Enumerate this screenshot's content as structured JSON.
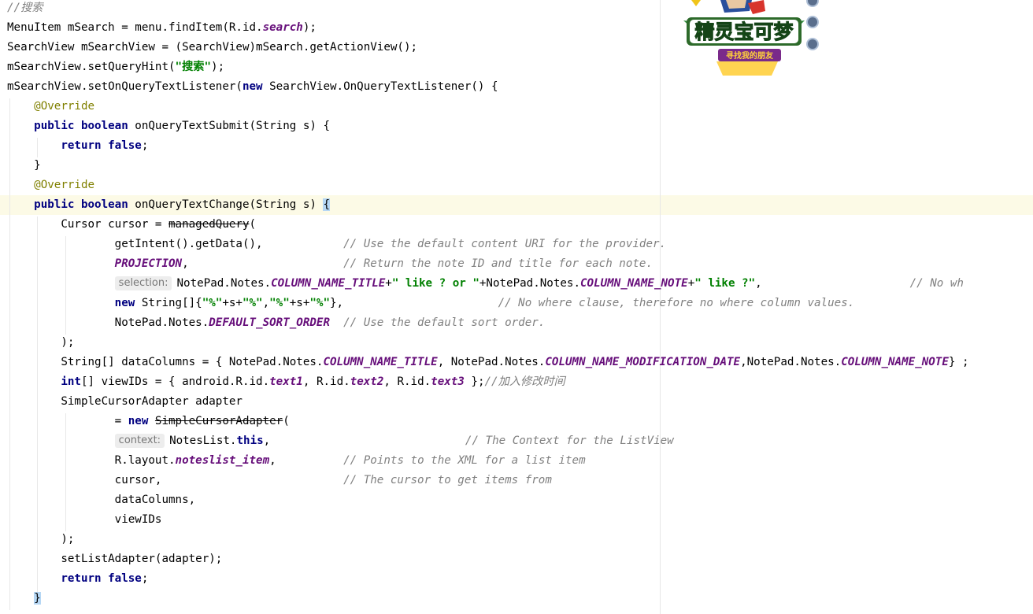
{
  "editor": {
    "lines": [
      {
        "segs": [
          {
            "c": "cmt",
            "t": "//"
          },
          {
            "c": "cmt cjk",
            "t": "搜索"
          }
        ]
      },
      {
        "segs": [
          {
            "t": "MenuItem mSearch = menu.findItem(R.id."
          },
          {
            "c": "fld",
            "t": "search"
          },
          {
            "t": ");"
          }
        ]
      },
      {
        "segs": [
          {
            "t": "SearchView mSearchView = (SearchView)mSearch.getActionView();"
          }
        ]
      },
      {
        "segs": [
          {
            "t": "mSearchView.setQueryHint("
          },
          {
            "c": "str",
            "t": "\""
          },
          {
            "c": "str cjk",
            "t": "搜索"
          },
          {
            "c": "str",
            "t": "\""
          },
          {
            "t": ");"
          }
        ]
      },
      {
        "segs": [
          {
            "t": "mSearchView.setOnQueryTextListener("
          },
          {
            "c": "kw",
            "t": "new"
          },
          {
            "t": " SearchView.OnQueryTextListener() {"
          }
        ]
      },
      {
        "segs": [
          {
            "t": "    "
          },
          {
            "c": "ann",
            "t": "@Override"
          }
        ]
      },
      {
        "segs": [
          {
            "t": "    "
          },
          {
            "c": "kw",
            "t": "public boolean"
          },
          {
            "t": " onQueryTextSubmit(String s) {"
          }
        ]
      },
      {
        "segs": [
          {
            "t": "        "
          },
          {
            "c": "kw",
            "t": "return false"
          },
          {
            "t": ";"
          }
        ]
      },
      {
        "segs": [
          {
            "t": "    }"
          }
        ]
      },
      {
        "segs": [
          {
            "t": "    "
          },
          {
            "c": "ann",
            "t": "@Override"
          }
        ]
      },
      {
        "segs": [
          {
            "t": "    "
          },
          {
            "c": "kw",
            "t": "public boolean"
          },
          {
            "t": " onQueryTextChange(String s) "
          },
          {
            "c": "brace-hl",
            "t": "{"
          }
        ]
      },
      {
        "segs": [
          {
            "t": "        Cursor cursor = "
          },
          {
            "c": "dep",
            "t": "managedQuery"
          },
          {
            "t": "("
          }
        ]
      },
      {
        "segs": [
          {
            "t": "                getIntent().getData(),            "
          },
          {
            "c": "cmt",
            "t": "// Use the default content URI for the provider."
          }
        ]
      },
      {
        "segs": [
          {
            "t": "                "
          },
          {
            "c": "fld",
            "t": "PROJECTION"
          },
          {
            "t": ",                       "
          },
          {
            "c": "cmt",
            "t": "// Return the note ID and title for each note."
          }
        ]
      },
      {
        "segs": [
          {
            "t": "                "
          },
          {
            "c": "hint",
            "t": "selection:"
          },
          {
            "t": "NotePad.Notes."
          },
          {
            "c": "fld",
            "t": "COLUMN_NAME_TITLE"
          },
          {
            "t": "+"
          },
          {
            "c": "str",
            "t": "\" like ? or \""
          },
          {
            "t": "+NotePad.Notes."
          },
          {
            "c": "fld",
            "t": "COLUMN_NAME_NOTE"
          },
          {
            "t": "+"
          },
          {
            "c": "str",
            "t": "\" like ?\""
          },
          {
            "t": ",                      "
          },
          {
            "c": "cmt",
            "t": "// No wh"
          }
        ]
      },
      {
        "segs": [
          {
            "t": "                "
          },
          {
            "c": "kw",
            "t": "new"
          },
          {
            "t": " String[]{"
          },
          {
            "c": "str",
            "t": "\"%\""
          },
          {
            "t": "+s+"
          },
          {
            "c": "str",
            "t": "\"%\""
          },
          {
            "t": ","
          },
          {
            "c": "str",
            "t": "\"%\""
          },
          {
            "t": "+s+"
          },
          {
            "c": "str",
            "t": "\"%\""
          },
          {
            "t": "},                       "
          },
          {
            "c": "cmt",
            "t": "// No where clause, therefore no where column values."
          }
        ]
      },
      {
        "segs": [
          {
            "t": "                NotePad.Notes."
          },
          {
            "c": "fld",
            "t": "DEFAULT_SORT_ORDER"
          },
          {
            "t": "  "
          },
          {
            "c": "cmt",
            "t": "// Use the default sort order."
          }
        ]
      },
      {
        "segs": [
          {
            "t": "        );"
          }
        ]
      },
      {
        "segs": [
          {
            "t": "        String[] dataColumns = { NotePad.Notes."
          },
          {
            "c": "fld",
            "t": "COLUMN_NAME_TITLE"
          },
          {
            "t": ", NotePad.Notes."
          },
          {
            "c": "fld",
            "t": "COLUMN_NAME_MODIFICATION_DATE"
          },
          {
            "t": ",NotePad.Notes."
          },
          {
            "c": "fld",
            "t": "COLUMN_NAME_NOTE"
          },
          {
            "t": "} ;"
          }
        ]
      },
      {
        "segs": [
          {
            "t": "        "
          },
          {
            "c": "kw",
            "t": "int"
          },
          {
            "t": "[] viewIDs = { android.R.id."
          },
          {
            "c": "fld",
            "t": "text1"
          },
          {
            "t": ", R.id."
          },
          {
            "c": "fld",
            "t": "text2"
          },
          {
            "t": ", R.id."
          },
          {
            "c": "fld",
            "t": "text3"
          },
          {
            "t": " };"
          },
          {
            "c": "cmt",
            "t": "//"
          },
          {
            "c": "cmt cjk",
            "t": "加入修改时间"
          }
        ]
      },
      {
        "segs": [
          {
            "t": "        SimpleCursorAdapter adapter"
          }
        ]
      },
      {
        "segs": [
          {
            "t": "                = "
          },
          {
            "c": "kw",
            "t": "new"
          },
          {
            "t": " "
          },
          {
            "c": "dep",
            "t": "SimpleCursorAdapter"
          },
          {
            "t": "("
          }
        ]
      },
      {
        "segs": [
          {
            "t": "                "
          },
          {
            "c": "hint",
            "t": "context:"
          },
          {
            "t": "NotesList."
          },
          {
            "c": "kw",
            "t": "this"
          },
          {
            "t": ",                             "
          },
          {
            "c": "cmt",
            "t": "// The Context for the ListView"
          }
        ]
      },
      {
        "segs": [
          {
            "t": "                R.layout."
          },
          {
            "c": "fld",
            "t": "noteslist_item"
          },
          {
            "t": ",          "
          },
          {
            "c": "cmt",
            "t": "// Points to the XML for a list item"
          }
        ]
      },
      {
        "segs": [
          {
            "t": "                cursor,                           "
          },
          {
            "c": "cmt",
            "t": "// The cursor to get items from"
          }
        ]
      },
      {
        "segs": [
          {
            "t": "                dataColumns,"
          }
        ]
      },
      {
        "segs": [
          {
            "t": "                viewIDs"
          }
        ]
      },
      {
        "segs": [
          {
            "t": "        );"
          }
        ]
      },
      {
        "segs": [
          {
            "t": "        setListAdapter(adapter);"
          }
        ]
      },
      {
        "segs": [
          {
            "t": "        "
          },
          {
            "c": "kw",
            "t": "return false"
          },
          {
            "t": ";"
          }
        ]
      },
      {
        "segs": [
          {
            "t": "    "
          },
          {
            "c": "brace-hl2",
            "t": "}"
          }
        ]
      }
    ]
  },
  "logo": {
    "text": "精灵宝可梦",
    "sub": "寻找我的朋友"
  },
  "colors": {
    "keyword": "#000080",
    "string": "#008000",
    "field": "#660e7a",
    "comment": "#808080",
    "annotation": "#808000",
    "caret_line": "#fcfae6"
  }
}
